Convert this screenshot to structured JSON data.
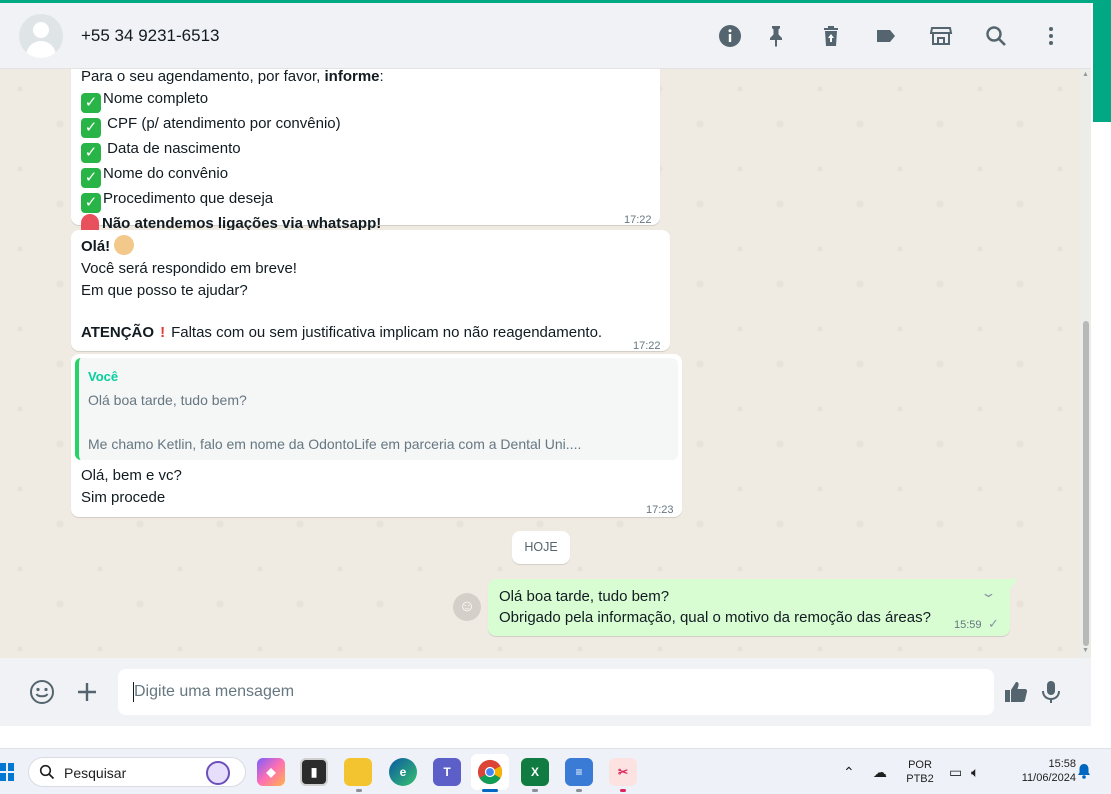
{
  "header": {
    "contact_name": "+55 34 9231-6513",
    "icons": [
      "info-icon",
      "pin-icon",
      "delete-icon",
      "label-icon",
      "store-icon",
      "search-icon",
      "menu-icon"
    ]
  },
  "messages": {
    "m1": {
      "lines": [
        "Para o seu agendamento, por favor, ",
        "informe",
        ":"
      ],
      "items": [
        "Nome completo",
        " CPF (p/ atendimento por convênio)",
        " Data de nascimento",
        "Nome do convênio",
        "Procedimento que deseja"
      ],
      "warning": "Não atendemos ligações via whatsapp!",
      "time": "17:22"
    },
    "m2": {
      "greeting": "Olá!",
      "line1": "Você será respondido em breve!",
      "line2": "Em que posso te ajudar?",
      "attention_label": "ATENÇÃO",
      "attention_text": "Faltas com ou sem justificativa implicam no não reagendamento.",
      "time": "17:22"
    },
    "m3": {
      "quote_author": "Você",
      "quote_line1": "Olá boa tarde, tudo bem?",
      "quote_line2": "Me chamo Ketlin, falo em nome da OdontoLife em parceria com a Dental Uni....",
      "line1": "Olá, bem e vc?",
      "line2": "Sim procede",
      "time": "17:23"
    },
    "date_chip": "HOJE",
    "out": {
      "line1": "Olá boa tarde, tudo bem?",
      "line2": "Obrigado pela informação, qual o motivo da remoção das áreas?",
      "time": "15:59",
      "status": "sent"
    }
  },
  "composer": {
    "placeholder": "Digite uma mensagem"
  },
  "taskbar": {
    "search_label": "Pesquisar",
    "apps": [
      "copilot",
      "terminal",
      "file-explorer",
      "edge",
      "teams",
      "chrome",
      "excel",
      "notepad",
      "snipping-tool"
    ],
    "active_app": "chrome",
    "lang_line1": "POR",
    "lang_line2": "PTB2",
    "clock_time": "15:58",
    "clock_date": "11/06/2024"
  },
  "colors": {
    "accent": "#00a884",
    "outgoing_bubble": "#d9fdd3",
    "chat_bg": "#efeae2",
    "quote_author": "#06cf9c"
  }
}
